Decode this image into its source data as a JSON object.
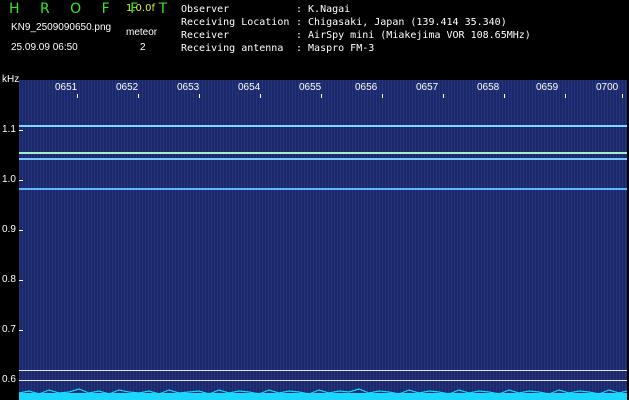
{
  "header": {
    "brand": "H R O F F T",
    "version": "1.0.0f",
    "filename": "KN9_2509090650.png",
    "mode_label": "meteor",
    "datetime": "25.09.09 06:50",
    "mode_value": "2"
  },
  "info": [
    {
      "label": "Observer",
      "value": ": K.Nagai"
    },
    {
      "label": "Receiving Location",
      "value": ": Chigasaki, Japan (139.414 35.340)"
    },
    {
      "label": "Receiver",
      "value": ": AirSpy mini (Miakejima VOR 108.65MHz)"
    },
    {
      "label": "Receiving antenna",
      "value": ": Maspro FM-3"
    }
  ],
  "spectrogram": {
    "y_unit": "kHz",
    "y_ticks": [
      "1.1",
      "1.0",
      "0.9",
      "0.8",
      "0.7",
      "0.6"
    ],
    "x_ticks": [
      "0651",
      "0652",
      "0653",
      "0654",
      "0655",
      "0656",
      "0657",
      "0658",
      "0659",
      "0700"
    ],
    "signal_colors": [
      "#7fd8ff",
      "#9ef0c8",
      "#78c8ff",
      "#5fb8ff"
    ],
    "background_color": "#1d2b6b",
    "baseline_color": "#1bd6ff"
  }
}
